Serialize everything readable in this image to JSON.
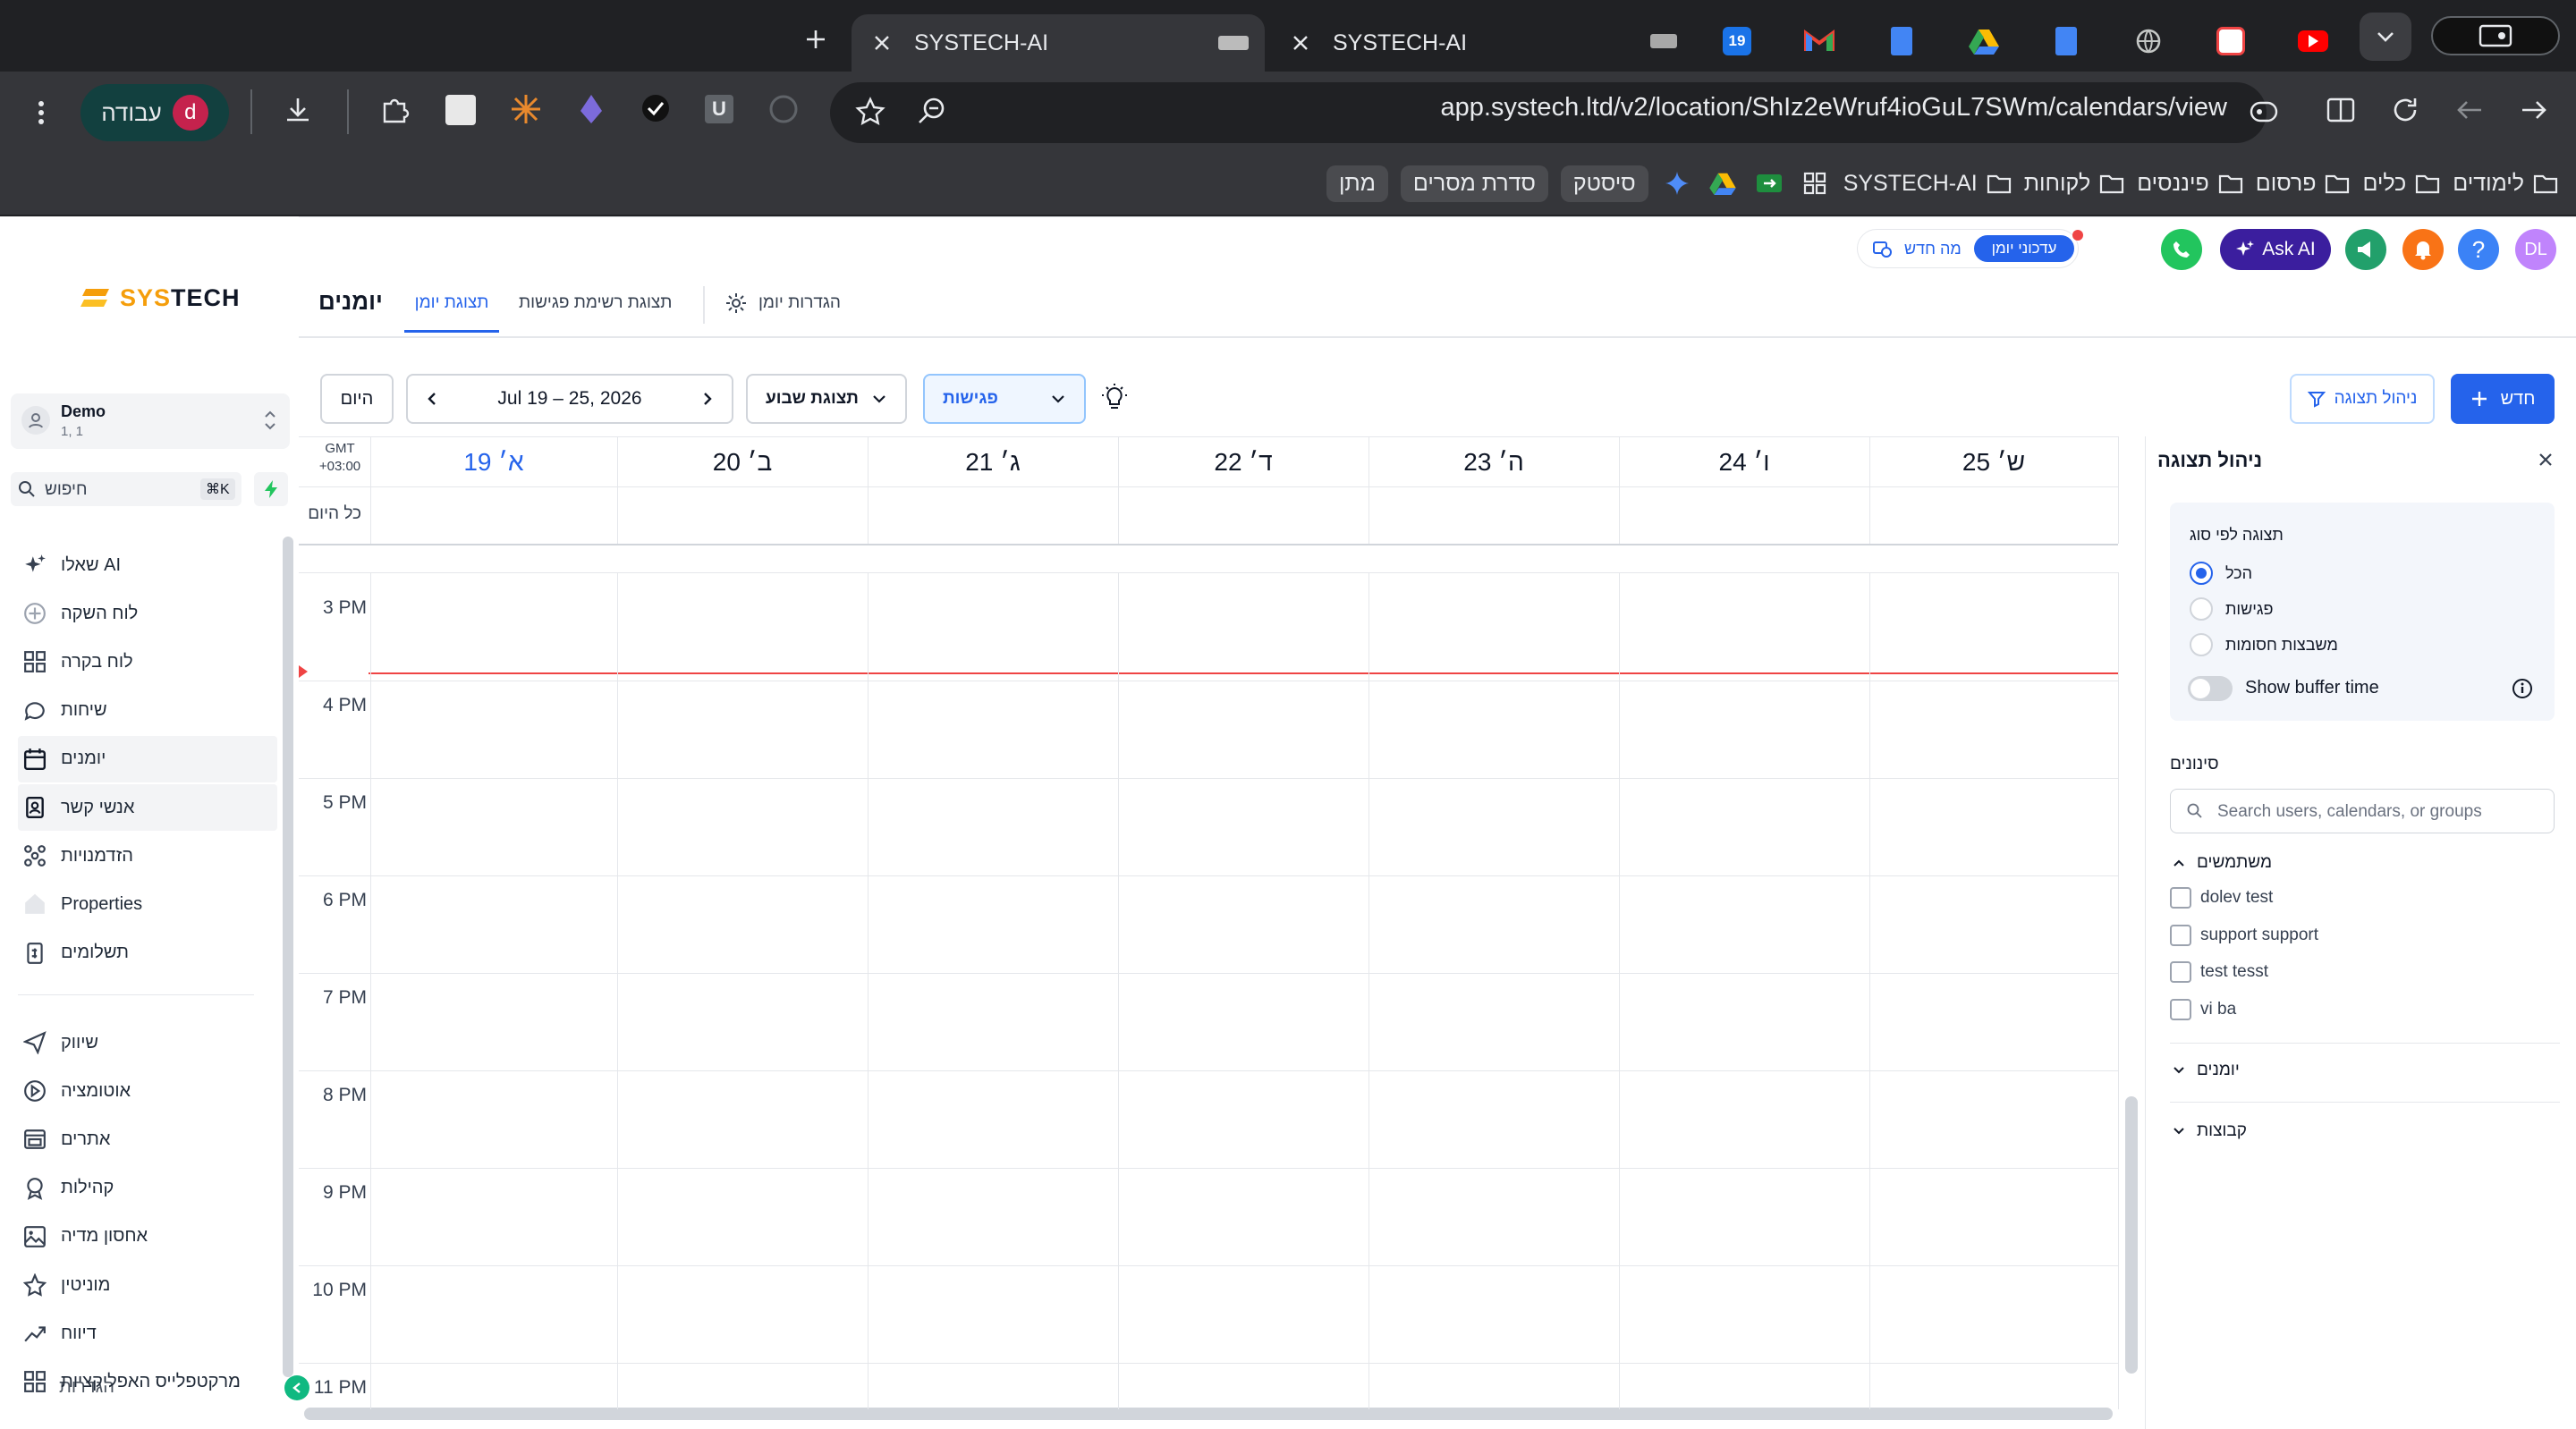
{
  "browser": {
    "tabs": [
      {
        "title": "SYSTECH-AI",
        "active": true
      },
      {
        "title": "SYSTECH-AI",
        "active": false
      }
    ],
    "url": "app.systech.ltd/v2/location/ShIz2eWruf4ioGuL7SWm/calendars/view",
    "profile_label": "עבודה",
    "profile_initial": "d",
    "pinned_badge": "19",
    "bookmarks": [
      {
        "label": "מתן",
        "type": "tag"
      },
      {
        "label": "סדרת מסרים",
        "type": "tag"
      },
      {
        "label": "סיסטק",
        "type": "tag"
      },
      {
        "label": "SYSTECH-AI",
        "type": "folder"
      },
      {
        "label": "לקוחות",
        "type": "folder"
      },
      {
        "label": "פיננסים",
        "type": "folder"
      },
      {
        "label": "פרסום",
        "type": "folder"
      },
      {
        "label": "כלים",
        "type": "folder"
      },
      {
        "label": "לימודים",
        "type": "folder"
      }
    ]
  },
  "header": {
    "user_initials": "DL",
    "help": "?",
    "ask_ai": "Ask AI",
    "whats_new": "מה חדש",
    "updates_badge": "עדכוני יומן",
    "page_title": "יומנים",
    "tabs": [
      {
        "label": "תצוגת יומן",
        "active": true
      },
      {
        "label": "תצוגת רשימת פגישות",
        "active": false
      }
    ],
    "settings": "הגדרות יומן"
  },
  "sidebar": {
    "logo": "SYSTECH",
    "account_name": "Demo",
    "account_sub": "1, 1",
    "search_placeholder": "חיפוש",
    "search_shortcut": "⌘K",
    "items": [
      {
        "label": "שאלו AI",
        "icon": "sparkle-icon"
      },
      {
        "label": "לוח השקה",
        "icon": "rocket-icon"
      },
      {
        "label": "לוח בקרה",
        "icon": "dashboard-icon"
      },
      {
        "label": "שיחות",
        "icon": "chat-icon"
      },
      {
        "label": "יומנים",
        "icon": "calendar-icon",
        "selected": true
      },
      {
        "label": "אנשי קשר",
        "icon": "contacts-icon",
        "selected": true
      },
      {
        "label": "הזדמנויות",
        "icon": "opportunities-icon"
      },
      {
        "label": "Properties",
        "icon": "home-icon"
      },
      {
        "label": "תשלומים",
        "icon": "payments-icon"
      }
    ],
    "items2": [
      {
        "label": "שיווק",
        "icon": "send-icon"
      },
      {
        "label": "אוטומציה",
        "icon": "automation-icon"
      },
      {
        "label": "אתרים",
        "icon": "sites-icon"
      },
      {
        "label": "קהילות",
        "icon": "award-icon"
      },
      {
        "label": "אחסון מדיה",
        "icon": "image-icon"
      },
      {
        "label": "מוניטין",
        "icon": "star-icon"
      },
      {
        "label": "דיווח",
        "icon": "chart-icon"
      },
      {
        "label": "מרקטפלייס האפליקציות",
        "icon": "apps-icon"
      }
    ],
    "overlap_label": "הגדרות"
  },
  "toolbar": {
    "today": "היום",
    "date_range": "Jul 19 – 25, 2026",
    "view_select": "תצוגת שבוע",
    "type_select": "פגישות",
    "manage_view": "ניהול תצוגה",
    "new_label": "חדש"
  },
  "calendar": {
    "timezone": "GMT",
    "timezone_offset": "+03:00",
    "all_day": "כל היום",
    "days": [
      {
        "label": "19 א׳",
        "today": true
      },
      {
        "label": "20 ב׳"
      },
      {
        "label": "21 ג׳"
      },
      {
        "label": "22 ד׳"
      },
      {
        "label": "23 ה׳"
      },
      {
        "label": "24 ו׳"
      },
      {
        "label": "25 ש׳"
      }
    ],
    "hours": [
      "3 PM",
      "4 PM",
      "5 PM",
      "6 PM",
      "7 PM",
      "8 PM",
      "9 PM",
      "10 PM",
      "11 PM"
    ]
  },
  "panel": {
    "title": "ניהול תצוגה",
    "view_by_type": "תצוגה לפי סוג",
    "options": [
      {
        "label": "הכל",
        "checked": true
      },
      {
        "label": "פגישות",
        "checked": false
      },
      {
        "label": "משבצות חסומות",
        "checked": false
      }
    ],
    "buffer_label": "Show buffer time",
    "filters": "סינונים",
    "filter_placeholder": "Search users, calendars, or groups",
    "users_header": "משתמשים",
    "users": [
      "dolev test",
      "support support",
      "test tesst",
      "vi ba"
    ],
    "calendars_header": "יומנים",
    "groups_header": "קבוצות"
  },
  "colors": {
    "accent": "#2563eb",
    "now_line": "#ef4444",
    "chrome_bg": "#35363a",
    "ask_ai": "#3b1e9e"
  }
}
